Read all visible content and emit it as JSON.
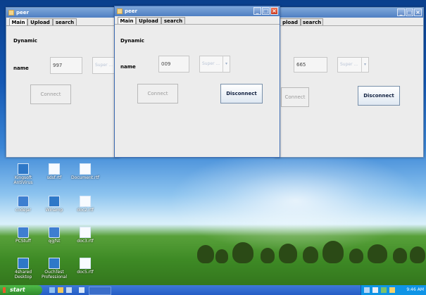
{
  "windows": [
    {
      "title": "peer",
      "tabs": [
        "Main",
        "Upload",
        "search"
      ],
      "section_label": "Dynamic",
      "name_label": "name",
      "name_value": "997",
      "combo_text": "Super ...",
      "connect_label": "Connect",
      "disconnect_label": ""
    },
    {
      "title": "peer",
      "tabs": [
        "Main",
        "Upload",
        "search"
      ],
      "section_label": "Dynamic",
      "name_label": "name",
      "name_value": "009",
      "combo_text": "Super ...",
      "connect_label": "Connect",
      "disconnect_label": "Disconnect"
    },
    {
      "title": "",
      "tabs": [
        "pload",
        "search"
      ],
      "section_label": "",
      "name_label": "",
      "name_value": "665",
      "combo_text": "Super ...",
      "connect_label": "Connect",
      "disconnect_label": "Disconnect"
    }
  ],
  "desktop_icons": [
    {
      "label": "Kingsoft AntiVirus",
      "icon": "antivirus-icon"
    },
    {
      "label": "sdsf.rtf",
      "icon": "document-icon"
    },
    {
      "label": "Document.rtf",
      "icon": "document-icon"
    },
    {
      "label": "codejar",
      "icon": "folder-icon"
    },
    {
      "label": "Winamp",
      "icon": "winamp-icon"
    },
    {
      "label": "doc2.rtf",
      "icon": "document-icon"
    },
    {
      "label": "PCStuff",
      "icon": "folder-icon"
    },
    {
      "label": "qgjfst",
      "icon": "folder-icon"
    },
    {
      "label": "doc3.rtf",
      "icon": "document-icon"
    },
    {
      "label": "4shared Desktop",
      "icon": "4shared-icon"
    },
    {
      "label": "OuchTest Professional",
      "icon": "app-icon"
    },
    {
      "label": "doc5.rtf",
      "icon": "document-icon"
    }
  ],
  "taskbar": {
    "start_label": "start",
    "clock": "9:46 AM"
  }
}
